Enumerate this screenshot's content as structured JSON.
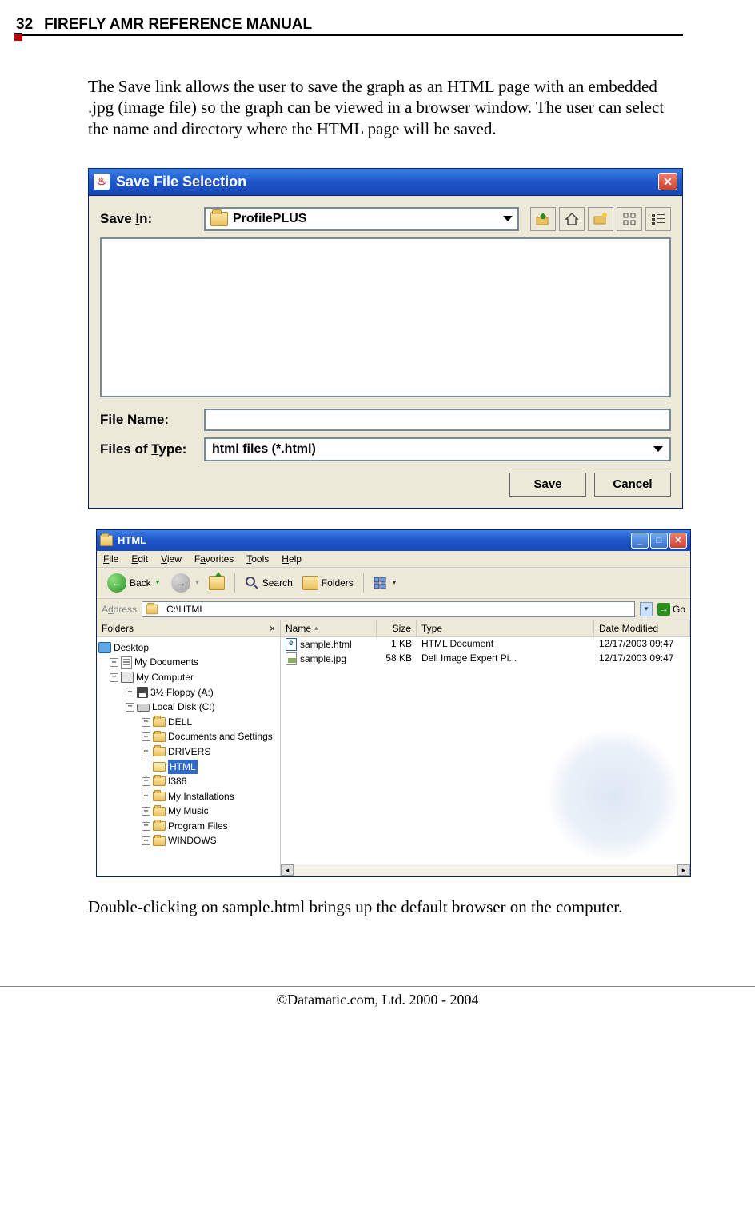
{
  "header": {
    "page_number": "32",
    "title": "FIREFLY AMR REFERENCE MANUAL"
  },
  "paragraph1": "The Save link allows the user to save the graph as an HTML page with an embedded .jpg (image file) so the graph can be viewed in a browser window.  The user can select the name and directory where the HTML page will be saved.",
  "save_dialog": {
    "title": "Save File Selection",
    "save_in_label": "Save In:",
    "save_in_value": "ProfilePLUS",
    "file_name_label": "File Name:",
    "file_name_value": "",
    "files_of_type_label": "Files of Type:",
    "files_of_type_value": "html files (*.html)",
    "save_button": "Save",
    "cancel_button": "Cancel"
  },
  "explorer": {
    "title": "HTML",
    "menu": {
      "file": "File",
      "edit": "Edit",
      "view": "View",
      "favorites": "Favorites",
      "tools": "Tools",
      "help": "Help"
    },
    "toolbar": {
      "back": "Back",
      "search": "Search",
      "folders": "Folders"
    },
    "address_label": "Address",
    "address_value": "C:\\HTML",
    "go_label": "Go",
    "folders_pane": {
      "header": "Folders",
      "tree": {
        "desktop": "Desktop",
        "my_documents": "My Documents",
        "my_computer": "My Computer",
        "floppy": "3½ Floppy (A:)",
        "local_disk": "Local Disk (C:)",
        "dell": "DELL",
        "docs_settings": "Documents and Settings",
        "drivers": "DRIVERS",
        "html": "HTML",
        "i386": "I386",
        "my_installations": "My Installations",
        "my_music": "My Music",
        "program_files": "Program Files",
        "windows": "WINDOWS"
      }
    },
    "list": {
      "columns": {
        "name": "Name",
        "size": "Size",
        "type": "Type",
        "date": "Date Modified"
      },
      "rows": [
        {
          "name": "sample.html",
          "size": "1 KB",
          "type": "HTML Document",
          "date": "12/17/2003 09:47"
        },
        {
          "name": "sample.jpg",
          "size": "58 KB",
          "type": "Dell Image Expert Pi...",
          "date": "12/17/2003 09:47"
        }
      ]
    }
  },
  "paragraph2": "Double-clicking on sample.html brings up the default browser on the computer.",
  "footer": "©Datamatic.com, Ltd. 2000 - 2004"
}
